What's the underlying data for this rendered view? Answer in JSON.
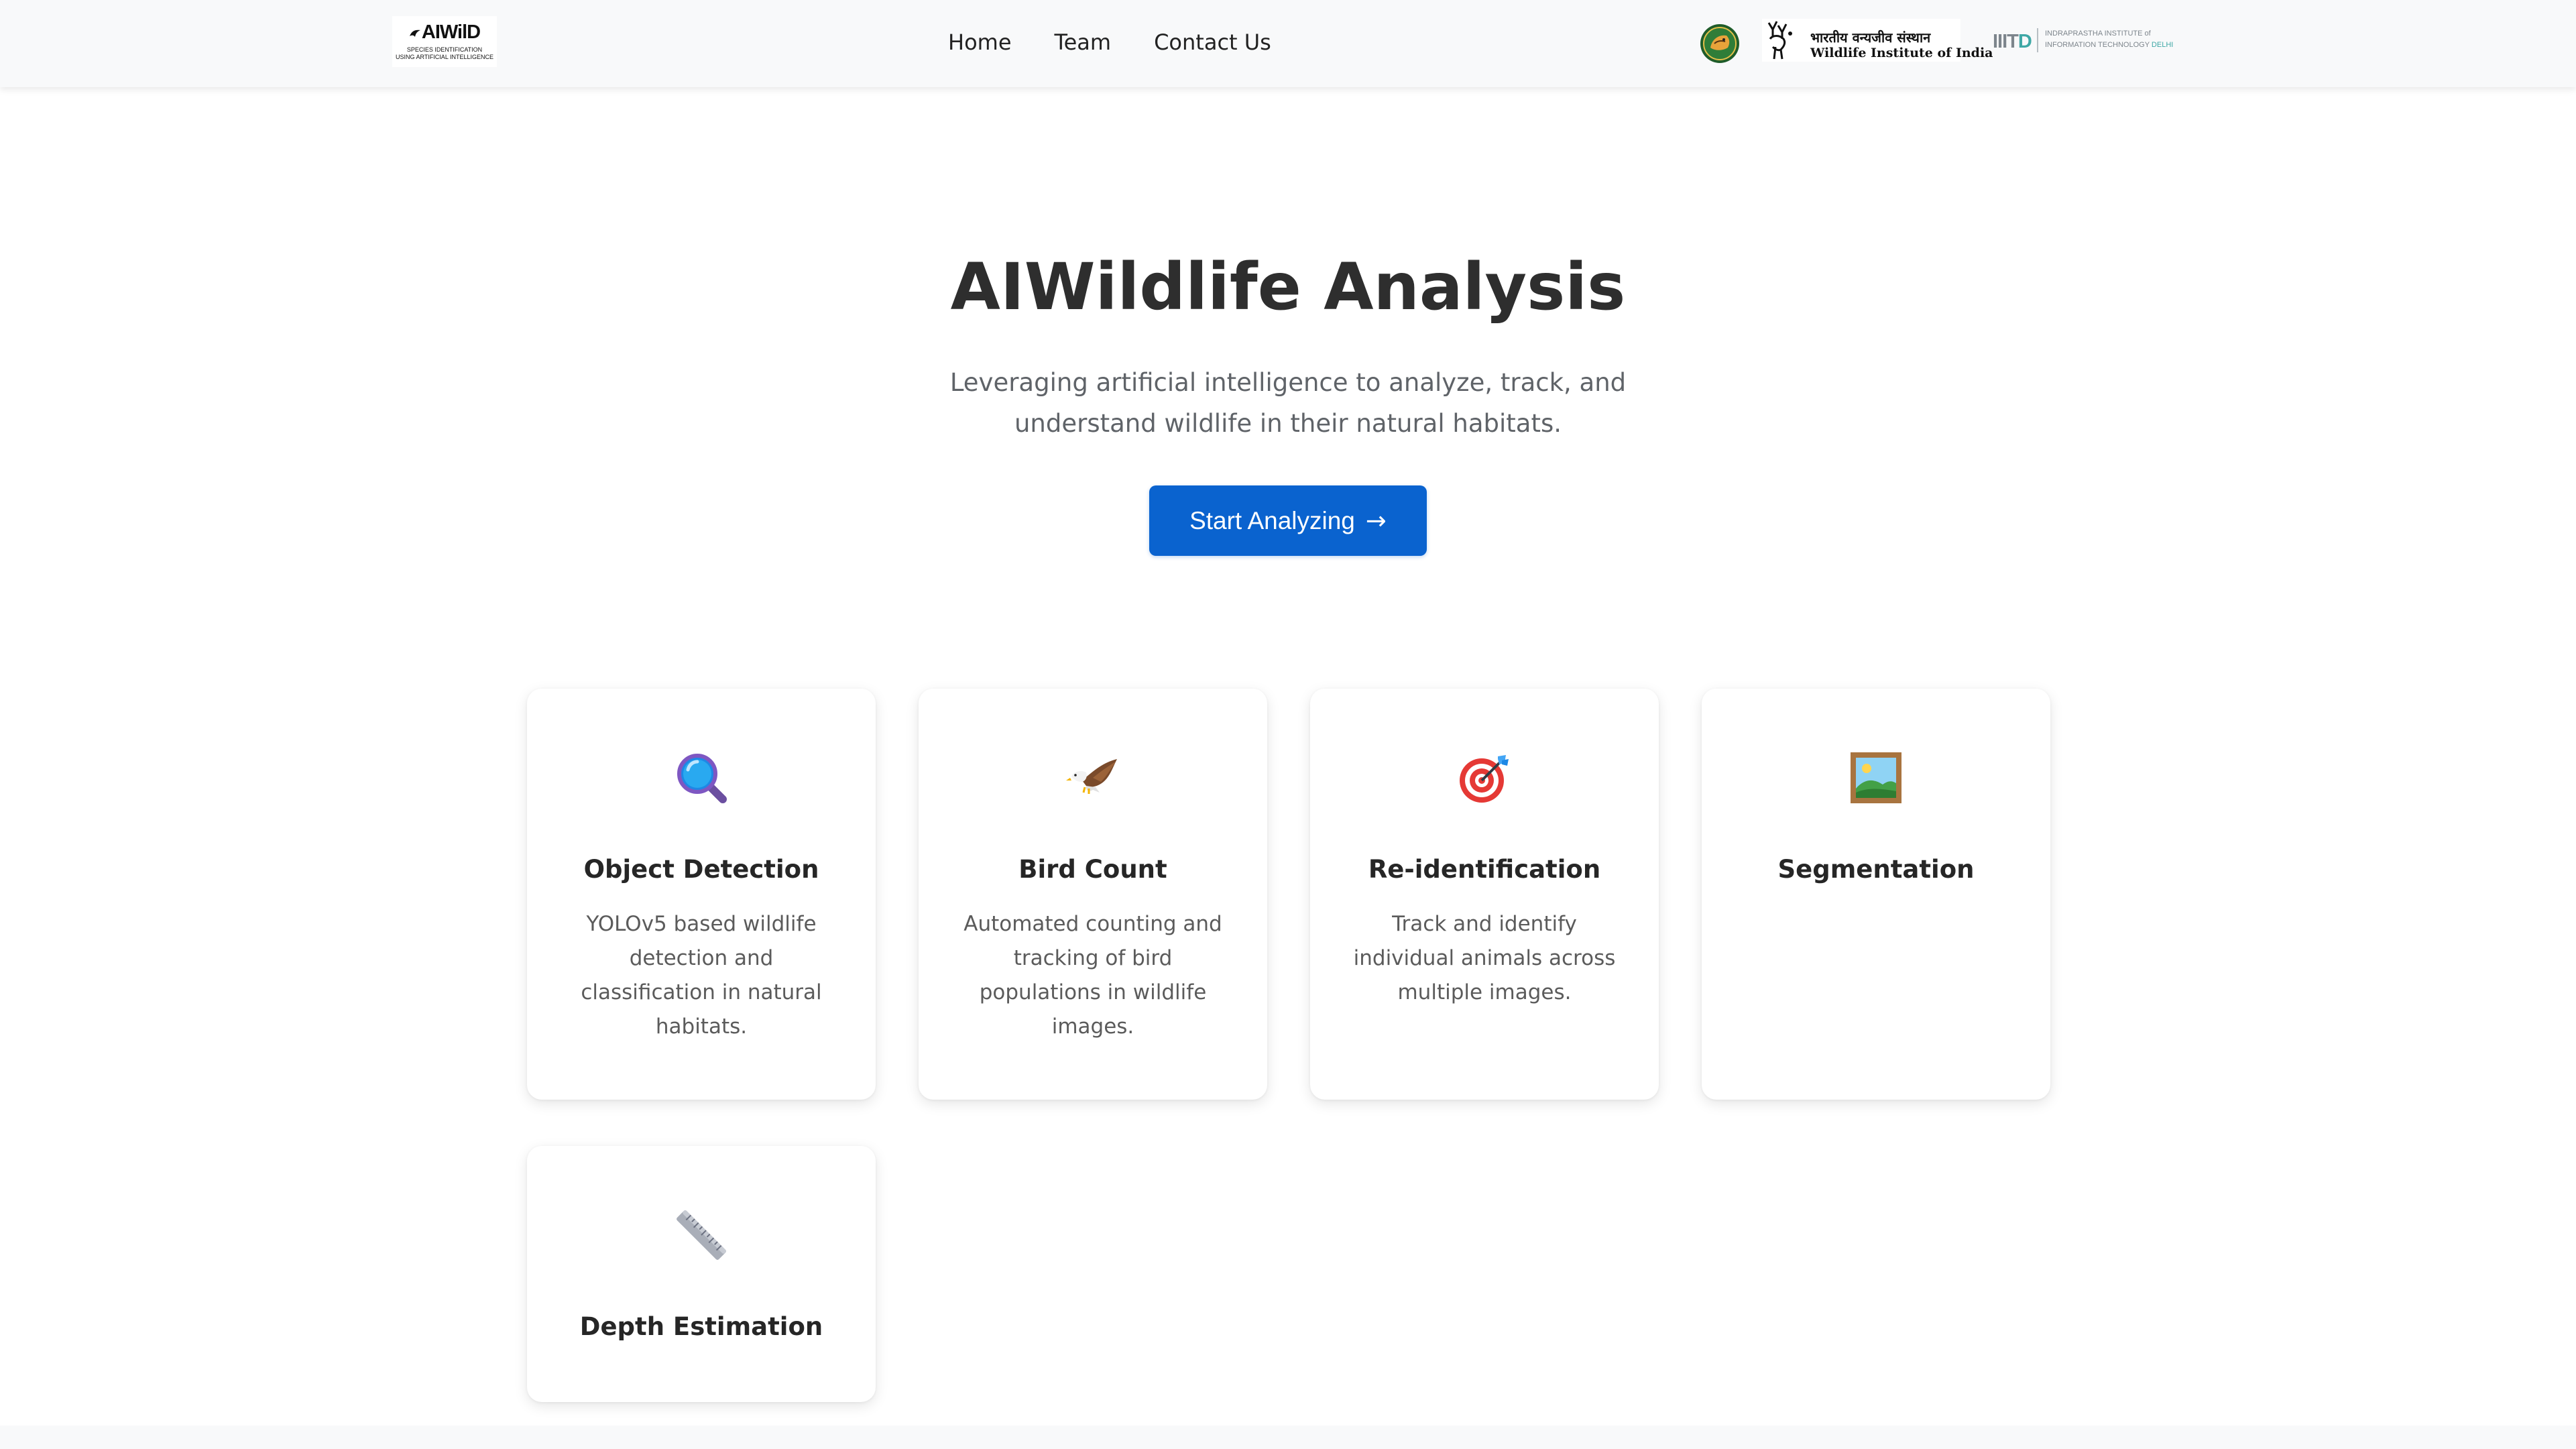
{
  "brand": {
    "name": "AIWilD",
    "tagline": "SPECIES IDENTIFICATION\nUSING ARTIFICIAL INTELLIGENCE"
  },
  "nav": {
    "links": [
      "Home",
      "Team",
      "Contact Us"
    ]
  },
  "partners": {
    "wii_hindi": "भारतीय वन्यजीव संस्थान",
    "wii_english": "Wildlife Institute of India",
    "iiitd_mark": "IIIT",
    "iiitd_mark_d": "D",
    "iiitd_line1": "INDRAPRASTHA INSTITUTE of",
    "iiitd_line2": "INFORMATION TECHNOLOGY",
    "iiitd_line2_city": "DELHI"
  },
  "hero": {
    "title": "AIWildlife Analysis",
    "subtitle": "Leveraging artificial intelligence to analyze, track, and understand wildlife in their natural habitats.",
    "cta_label": "Start Analyzing",
    "cta_arrow": "→"
  },
  "cards": [
    {
      "title": "Object Detection",
      "description": "YOLOv5 based wildlife detection and classification in natural habitats.",
      "icon": "magnifying-glass-icon"
    },
    {
      "title": "Bird Count",
      "description": "Automated counting and tracking of bird populations in wildlife images.",
      "icon": "eagle-icon"
    },
    {
      "title": "Re-identification",
      "description": "Track and identify individual animals across multiple images.",
      "icon": "target-icon"
    },
    {
      "title": "Segmentation",
      "description": "",
      "icon": "framed-picture-icon"
    },
    {
      "title": "Depth Estimation",
      "description": "",
      "icon": "ruler-icon"
    }
  ],
  "colors": {
    "primary": "#0a63cf",
    "nav_bg": "#f8f9fa",
    "title_text": "#2e2e2e",
    "muted_text": "#5f6368"
  }
}
